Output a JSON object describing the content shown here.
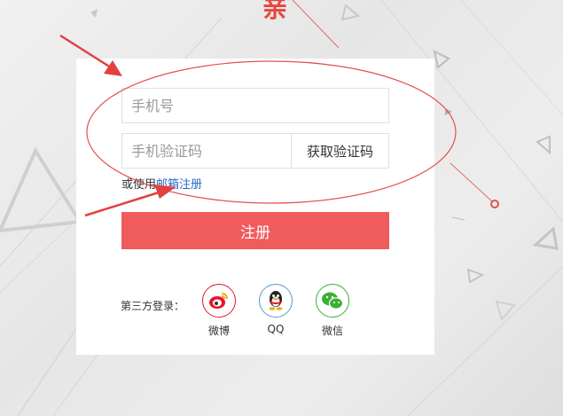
{
  "header": {
    "title_fragment": "亲"
  },
  "form": {
    "phone_placeholder": "手机号",
    "code_placeholder": "手机验证码",
    "get_code_label": "获取验证码",
    "alt_prefix": "或使用",
    "email_link": "邮箱注册",
    "register_label": "注册"
  },
  "third_party": {
    "label": "第三方登录：",
    "providers": [
      {
        "name": "微博",
        "color": "#e6162d"
      },
      {
        "name": "QQ",
        "color": "#5a96d6"
      },
      {
        "name": "微信",
        "color": "#3cb034"
      }
    ]
  },
  "colors": {
    "accent": "#f05b5b",
    "link": "#2a67c7"
  }
}
